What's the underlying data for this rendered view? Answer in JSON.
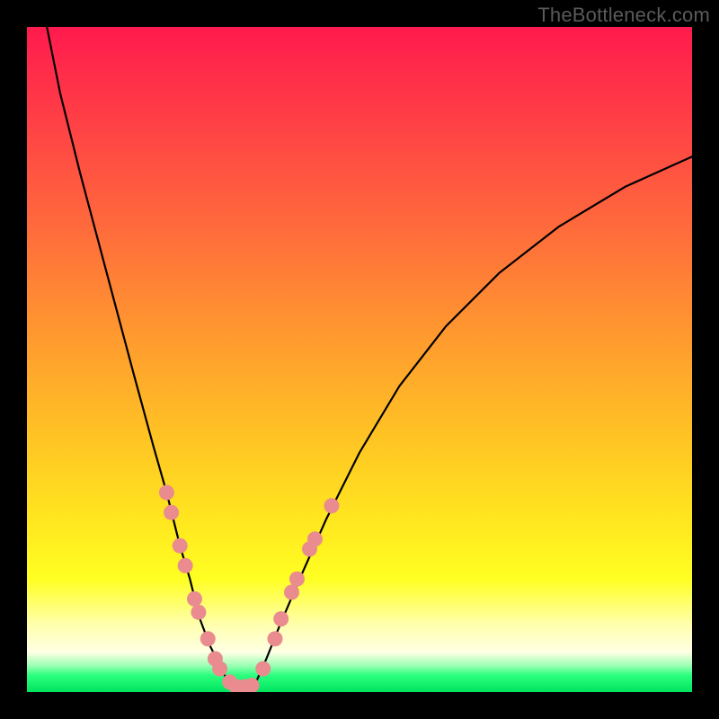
{
  "watermark": "TheBottleneck.com",
  "chart_data": {
    "type": "line",
    "title": "",
    "xlabel": "",
    "ylabel": "",
    "xlim": [
      0,
      100
    ],
    "ylim": [
      0,
      100
    ],
    "grid": false,
    "legend": false,
    "background": "gradient: red(top) → orange → yellow → green(bottom)",
    "series": [
      {
        "name": "left-branch",
        "x": [
          3,
          5,
          8,
          12,
          16,
          19,
          21,
          23,
          24.5,
          26,
          27.5,
          29,
          30,
          31
        ],
        "values": [
          100,
          90,
          78,
          63,
          48,
          37,
          30,
          22,
          17,
          11,
          7,
          4,
          2,
          0.5
        ]
      },
      {
        "name": "right-branch",
        "x": [
          34,
          36,
          38,
          41,
          45,
          50,
          56,
          63,
          71,
          80,
          90,
          100
        ],
        "values": [
          0.5,
          5,
          10,
          17,
          26,
          36,
          46,
          55,
          63,
          70,
          76,
          80.5
        ]
      }
    ],
    "markers": {
      "name": "highlighted-points",
      "color": "#e98b8f",
      "points": [
        {
          "x": 21.0,
          "y": 30.0
        },
        {
          "x": 21.7,
          "y": 27.0
        },
        {
          "x": 23.0,
          "y": 22.0
        },
        {
          "x": 23.8,
          "y": 19.0
        },
        {
          "x": 25.2,
          "y": 14.0
        },
        {
          "x": 25.8,
          "y": 12.0
        },
        {
          "x": 27.2,
          "y": 8.0
        },
        {
          "x": 28.3,
          "y": 5.0
        },
        {
          "x": 29.0,
          "y": 3.5
        },
        {
          "x": 30.5,
          "y": 1.5
        },
        {
          "x": 31.5,
          "y": 0.8
        },
        {
          "x": 32.7,
          "y": 0.8
        },
        {
          "x": 33.8,
          "y": 1.0
        },
        {
          "x": 35.5,
          "y": 3.5
        },
        {
          "x": 37.3,
          "y": 8.0
        },
        {
          "x": 38.2,
          "y": 11.0
        },
        {
          "x": 39.8,
          "y": 15.0
        },
        {
          "x": 40.6,
          "y": 17.0
        },
        {
          "x": 42.5,
          "y": 21.5
        },
        {
          "x": 43.3,
          "y": 23.0
        },
        {
          "x": 45.8,
          "y": 28.0
        }
      ]
    }
  }
}
